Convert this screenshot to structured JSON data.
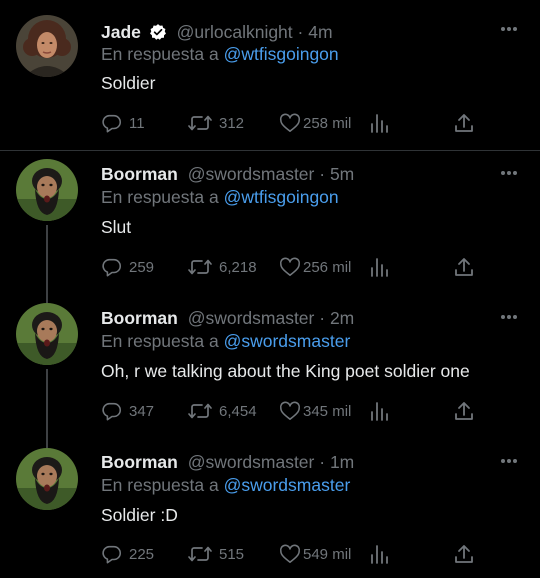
{
  "colors": {
    "background": "#000000",
    "text": "#e7e9ea",
    "muted": "#71767b",
    "mention": "#4a9eed",
    "divider": "#2f3336",
    "verified_badge": "#ffffff"
  },
  "tweets": [
    {
      "name": "Jade",
      "verified": true,
      "handle": "@urlocalknight",
      "dot": "·",
      "time": "4m",
      "reply_prefix": "En respuesta a",
      "reply_to": "@wtfisgoingon",
      "text": "Soldier",
      "replies": "11",
      "retweets": "312",
      "likes": "258 mil",
      "avatar_icon": "profile-photo-curly-hair"
    },
    {
      "name": "Boorman",
      "verified": false,
      "handle": "@swordsmaster",
      "dot": "·",
      "time": "5m",
      "reply_prefix": "En respuesta a",
      "reply_to": "@wtfisgoingon",
      "text": "Slut",
      "replies": "259",
      "retweets": "6,218",
      "likes": "256 mil",
      "avatar_icon": "profile-photo-bearded-man"
    },
    {
      "name": "Boorman",
      "verified": false,
      "handle": "@swordsmaster",
      "dot": "·",
      "time": "2m",
      "reply_prefix": "En respuesta a",
      "reply_to": "@swordsmaster",
      "text": "Oh, r we talking about the King poet soldier one",
      "replies": "347",
      "retweets": "6,454",
      "likes": "345 mil",
      "avatar_icon": "profile-photo-bearded-man"
    },
    {
      "name": "Boorman",
      "verified": false,
      "handle": "@swordsmaster",
      "dot": "·",
      "time": "1m",
      "reply_prefix": "En respuesta a",
      "reply_to": "@swordsmaster",
      "text": "Soldier :D",
      "replies": "225",
      "retweets": "515",
      "likes": "549 mil",
      "avatar_icon": "profile-photo-bearded-man"
    }
  ]
}
